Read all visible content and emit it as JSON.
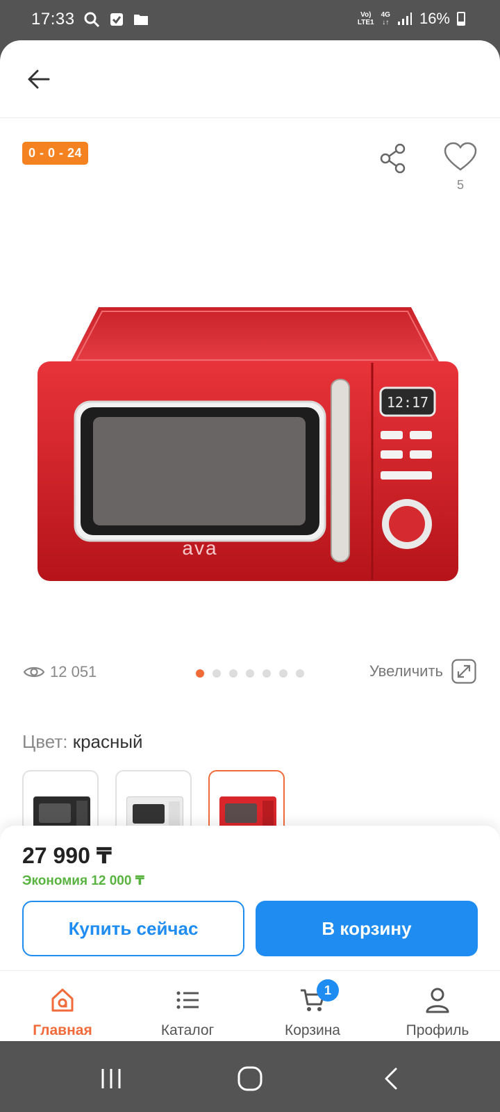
{
  "status_bar": {
    "time": "17:33",
    "network_top": "Vo)",
    "network_bottom": "LTE1",
    "net_gen": "4G",
    "battery": "16%"
  },
  "product": {
    "installment_badge": "0 - 0 - 24",
    "favorites_count": "5",
    "views_count": "12 051",
    "zoom_label": "Увеличить",
    "color_label": "Цвет:",
    "color_value": "красный",
    "image_count": 7,
    "active_image_index": 0,
    "brand_on_image": "ava",
    "display_on_image": "12:17",
    "swatches": [
      {
        "name": "black",
        "color": "#2b2b2b",
        "selected": false
      },
      {
        "name": "white",
        "color": "#f1f1f1",
        "selected": false
      },
      {
        "name": "red",
        "color": "#d8262b",
        "selected": true
      }
    ]
  },
  "purchase": {
    "price": "27 990 ₸",
    "saving": "Экономия 12 000 ₸",
    "buy_now_label": "Купить сейчас",
    "add_to_cart_label": "В корзину"
  },
  "bottom_nav": {
    "items": [
      {
        "label": "Главная",
        "icon": "home-icon",
        "active": true
      },
      {
        "label": "Каталог",
        "icon": "catalog-list-icon",
        "active": false
      },
      {
        "label": "Корзина",
        "icon": "cart-icon",
        "active": false,
        "badge": "1"
      },
      {
        "label": "Профиль",
        "icon": "profile-icon",
        "active": false
      }
    ]
  },
  "colors": {
    "accent_orange": "#f06a3a",
    "badge_orange": "#f58220",
    "primary_blue": "#1e8cf0",
    "saving_green": "#58b33f"
  }
}
